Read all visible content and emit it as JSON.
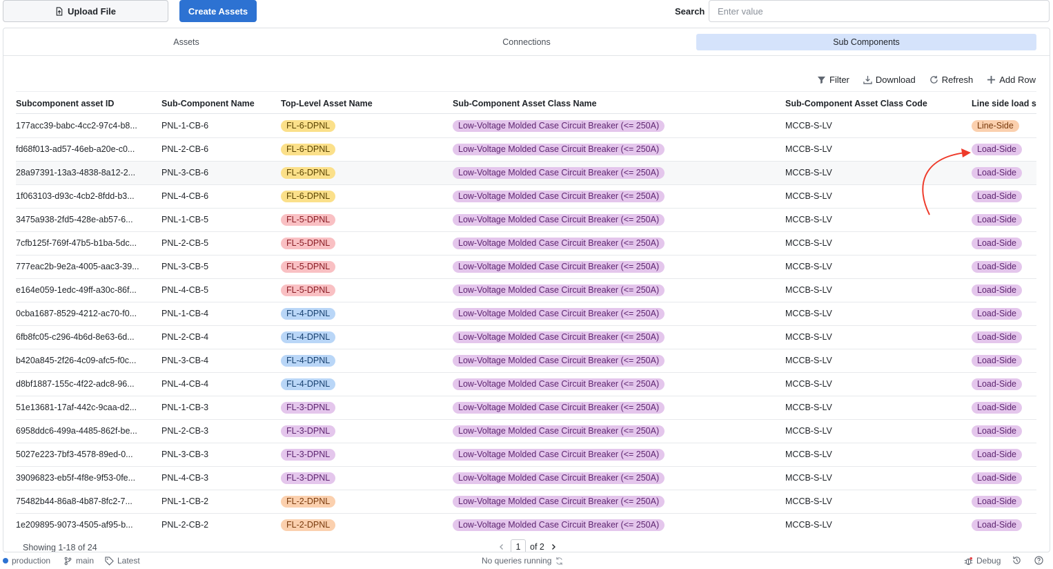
{
  "toolbar": {
    "upload_label": "Upload File",
    "create_label": "Create Assets",
    "search_label": "Search",
    "search_placeholder": "Enter value"
  },
  "tabs": [
    "Assets",
    "Connections",
    "Sub Components"
  ],
  "active_tab": "Sub Components",
  "actions": {
    "filter": "Filter",
    "download": "Download",
    "refresh": "Refresh",
    "add_row": "Add Row"
  },
  "columns": [
    "Subcomponent asset ID",
    "Sub-Component Name",
    "Top-Level Asset Name",
    "Sub-Component Asset Class Name",
    "Sub-Component Asset Class Code",
    "Line side load si..."
  ],
  "rows": [
    {
      "id": "177acc39-babc-4cc2-97c4-b8...",
      "name": "PNL-1-CB-6",
      "top": "FL-6-DPNL",
      "tone": "fl6",
      "cls": "Low-Voltage Molded Case Circuit Breaker (<= 250A)",
      "code": "MCCB-S-LV",
      "side": "Line-Side"
    },
    {
      "id": "fd68f013-ad57-46eb-a20e-c0...",
      "name": "PNL-2-CB-6",
      "top": "FL-6-DPNL",
      "tone": "fl6",
      "cls": "Low-Voltage Molded Case Circuit Breaker (<= 250A)",
      "code": "MCCB-S-LV",
      "side": "Load-Side"
    },
    {
      "id": "28a97391-13a3-4838-8a12-2...",
      "name": "PNL-3-CB-6",
      "top": "FL-6-DPNL",
      "tone": "fl6",
      "cls": "Low-Voltage Molded Case Circuit Breaker (<= 250A)",
      "code": "MCCB-S-LV",
      "side": "Load-Side"
    },
    {
      "id": "1f063103-d93c-4cb2-8fdd-b3...",
      "name": "PNL-4-CB-6",
      "top": "FL-6-DPNL",
      "tone": "fl6",
      "cls": "Low-Voltage Molded Case Circuit Breaker (<= 250A)",
      "code": "MCCB-S-LV",
      "side": "Load-Side"
    },
    {
      "id": "3475a938-2fd5-428e-ab57-6...",
      "name": "PNL-1-CB-5",
      "top": "FL-5-DPNL",
      "tone": "fl5",
      "cls": "Low-Voltage Molded Case Circuit Breaker (<= 250A)",
      "code": "MCCB-S-LV",
      "side": "Load-Side"
    },
    {
      "id": "7cfb125f-769f-47b5-b1ba-5dc...",
      "name": "PNL-2-CB-5",
      "top": "FL-5-DPNL",
      "tone": "fl5",
      "cls": "Low-Voltage Molded Case Circuit Breaker (<= 250A)",
      "code": "MCCB-S-LV",
      "side": "Load-Side"
    },
    {
      "id": "777eac2b-9e2a-4005-aac3-39...",
      "name": "PNL-3-CB-5",
      "top": "FL-5-DPNL",
      "tone": "fl5",
      "cls": "Low-Voltage Molded Case Circuit Breaker (<= 250A)",
      "code": "MCCB-S-LV",
      "side": "Load-Side"
    },
    {
      "id": "e164e059-1edc-49ff-a30c-86f...",
      "name": "PNL-4-CB-5",
      "top": "FL-5-DPNL",
      "tone": "fl5",
      "cls": "Low-Voltage Molded Case Circuit Breaker (<= 250A)",
      "code": "MCCB-S-LV",
      "side": "Load-Side"
    },
    {
      "id": "0cba1687-8529-4212-ac70-f0...",
      "name": "PNL-1-CB-4",
      "top": "FL-4-DPNL",
      "tone": "fl4",
      "cls": "Low-Voltage Molded Case Circuit Breaker (<= 250A)",
      "code": "MCCB-S-LV",
      "side": "Load-Side"
    },
    {
      "id": "6fb8fc05-c296-4b6d-8e63-6d...",
      "name": "PNL-2-CB-4",
      "top": "FL-4-DPNL",
      "tone": "fl4",
      "cls": "Low-Voltage Molded Case Circuit Breaker (<= 250A)",
      "code": "MCCB-S-LV",
      "side": "Load-Side"
    },
    {
      "id": "b420a845-2f26-4c09-afc5-f0c...",
      "name": "PNL-3-CB-4",
      "top": "FL-4-DPNL",
      "tone": "fl4",
      "cls": "Low-Voltage Molded Case Circuit Breaker (<= 250A)",
      "code": "MCCB-S-LV",
      "side": "Load-Side"
    },
    {
      "id": "d8bf1887-155c-4f22-adc8-96...",
      "name": "PNL-4-CB-4",
      "top": "FL-4-DPNL",
      "tone": "fl4",
      "cls": "Low-Voltage Molded Case Circuit Breaker (<= 250A)",
      "code": "MCCB-S-LV",
      "side": "Load-Side"
    },
    {
      "id": "51e13681-17af-442c-9caa-d2...",
      "name": "PNL-1-CB-3",
      "top": "FL-3-DPNL",
      "tone": "fl3",
      "cls": "Low-Voltage Molded Case Circuit Breaker (<= 250A)",
      "code": "MCCB-S-LV",
      "side": "Load-Side"
    },
    {
      "id": "6958ddc6-499a-4485-862f-be...",
      "name": "PNL-2-CB-3",
      "top": "FL-3-DPNL",
      "tone": "fl3",
      "cls": "Low-Voltage Molded Case Circuit Breaker (<= 250A)",
      "code": "MCCB-S-LV",
      "side": "Load-Side"
    },
    {
      "id": "5027e223-7bf3-4578-89ed-0...",
      "name": "PNL-3-CB-3",
      "top": "FL-3-DPNL",
      "tone": "fl3",
      "cls": "Low-Voltage Molded Case Circuit Breaker (<= 250A)",
      "code": "MCCB-S-LV",
      "side": "Load-Side"
    },
    {
      "id": "39096823-eb5f-4f8e-9f53-0fe...",
      "name": "PNL-4-CB-3",
      "top": "FL-3-DPNL",
      "tone": "fl3",
      "cls": "Low-Voltage Molded Case Circuit Breaker (<= 250A)",
      "code": "MCCB-S-LV",
      "side": "Load-Side"
    },
    {
      "id": "75482b44-86a8-4b87-8fc2-7...",
      "name": "PNL-1-CB-2",
      "top": "FL-2-DPNL",
      "tone": "fl2",
      "cls": "Low-Voltage Molded Case Circuit Breaker (<= 250A)",
      "code": "MCCB-S-LV",
      "side": "Load-Side"
    },
    {
      "id": "1e209895-9073-4505-af95-b...",
      "name": "PNL-2-CB-2",
      "top": "FL-2-DPNL",
      "tone": "fl2",
      "cls": "Low-Voltage Molded Case Circuit Breaker (<= 250A)",
      "code": "MCCB-S-LV",
      "side": "Load-Side"
    }
  ],
  "footer": {
    "showing": "Showing 1-18 of 24",
    "page": "1",
    "of_pages": "of 2"
  },
  "statusbar": {
    "env": "production",
    "branch": "main",
    "version": "Latest",
    "queries": "No queries running",
    "debug": "Debug"
  },
  "colors": {
    "primary": "#2d72d2",
    "active_tab": "#d5e3fb",
    "annotation_arrow": "#ee3a2a"
  }
}
